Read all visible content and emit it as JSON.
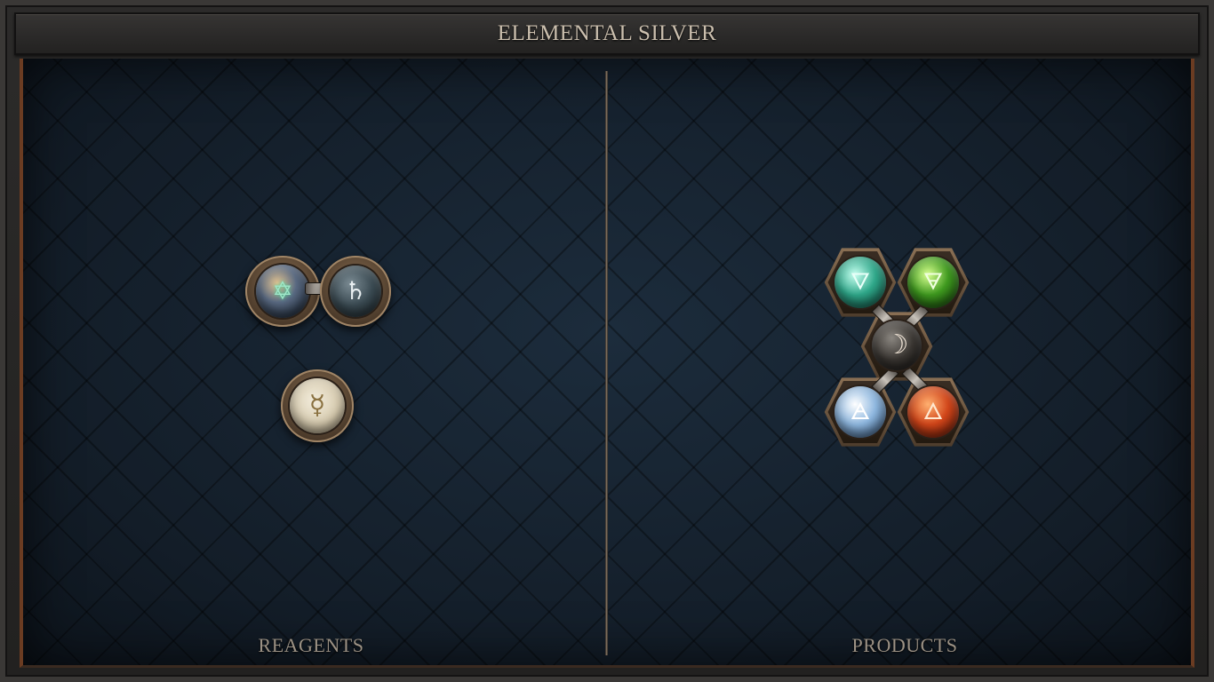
{
  "header": {
    "title": "ELEMENTAL SILVER"
  },
  "panels": {
    "reagents": {
      "label": "REAGENTS",
      "items": [
        {
          "name": "salt-bonded-pair",
          "symbols": [
            "✡",
            "♄"
          ]
        },
        {
          "name": "quicksilver",
          "symbol": "☿"
        }
      ]
    },
    "products": {
      "label": "PRODUCTS",
      "center": {
        "name": "silver",
        "symbol": "☽"
      },
      "elements": [
        {
          "name": "water",
          "symbol": "🜄",
          "color": "#2fa88a"
        },
        {
          "name": "earth",
          "symbol": "🜃",
          "color": "#3f9a1f"
        },
        {
          "name": "air",
          "symbol": "🜁",
          "color": "#8fb8e0"
        },
        {
          "name": "fire",
          "symbol": "🜂",
          "color": "#d2461a"
        }
      ]
    }
  },
  "colors": {
    "title_text": "#cbbfae",
    "label_text": "#9b9184",
    "board_bg": "#14202c",
    "frame_accent": "#6b3c22"
  }
}
